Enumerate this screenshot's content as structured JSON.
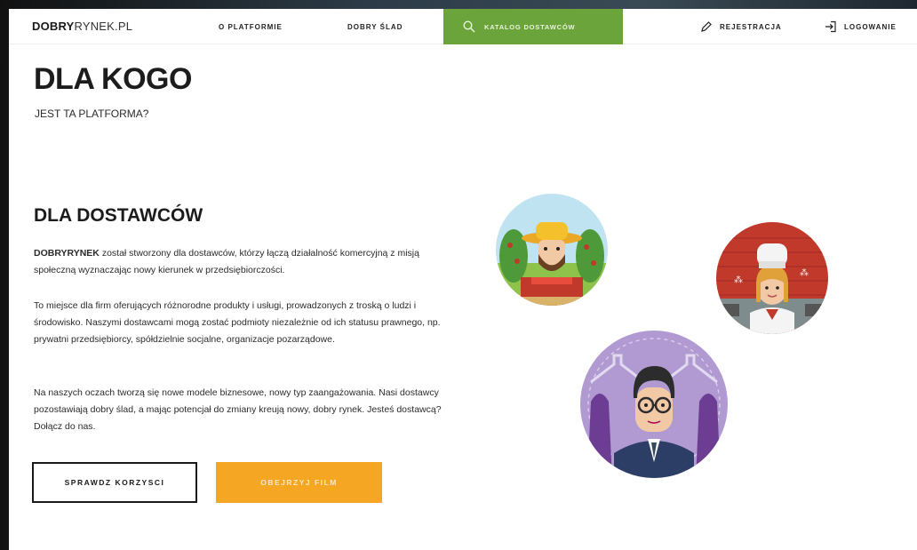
{
  "nav": {
    "logo_bold": "DOBRY",
    "logo_rest": "RYNEK.PL",
    "about": "O PLATFORMIE",
    "good_trace": "DOBRY ŚLAD",
    "catalog": "KATALOG DOSTAWCÓW",
    "register": "REJESTRACJA",
    "login": "LOGOWANIE",
    "accent": "#6ba43a"
  },
  "hero": {
    "title": "DLA KOGO",
    "subtitle": "JEST TA PLATFORMA?"
  },
  "section": {
    "title": "DLA DOSTAWCÓW",
    "p1_bold": "DOBRYRYNEK",
    "p1_rest": " został stworzony dla dostawców, którzy łączą działalność komercyjną z misją społeczną wyznaczając nowy kierunek w przedsiębiorczości.",
    "p2": "To miejsce dla firm oferujących różnorodne produkty i usługi, prowadzonych z troską o ludzi i środowisko. Naszymi dostawcami mogą zostać podmioty niezależnie od ich statusu prawnego, np. prywatni przedsiębiorcy, spółdzielnie socjalne, organizacje pozarządowe.",
    "p3": "Na naszych oczach tworzą się nowe modele biznesowe, nowy typ zaangażowania. Nasi dostawcy pozostawiają dobry ślad, a mając potencjał do zmiany kreują nowy, dobry rynek. Jesteś dostawcą? Dołącz do nas.",
    "btn_benefits": "SPRAWDZ KORZYSCI",
    "btn_film": "OBEJRZYJ FILM",
    "btn_color": "#f5a623"
  },
  "illustrations": {
    "farmer": "farmer-avatar-icon",
    "cook": "cook-avatar-icon",
    "tailor": "tailor-avatar-icon"
  }
}
